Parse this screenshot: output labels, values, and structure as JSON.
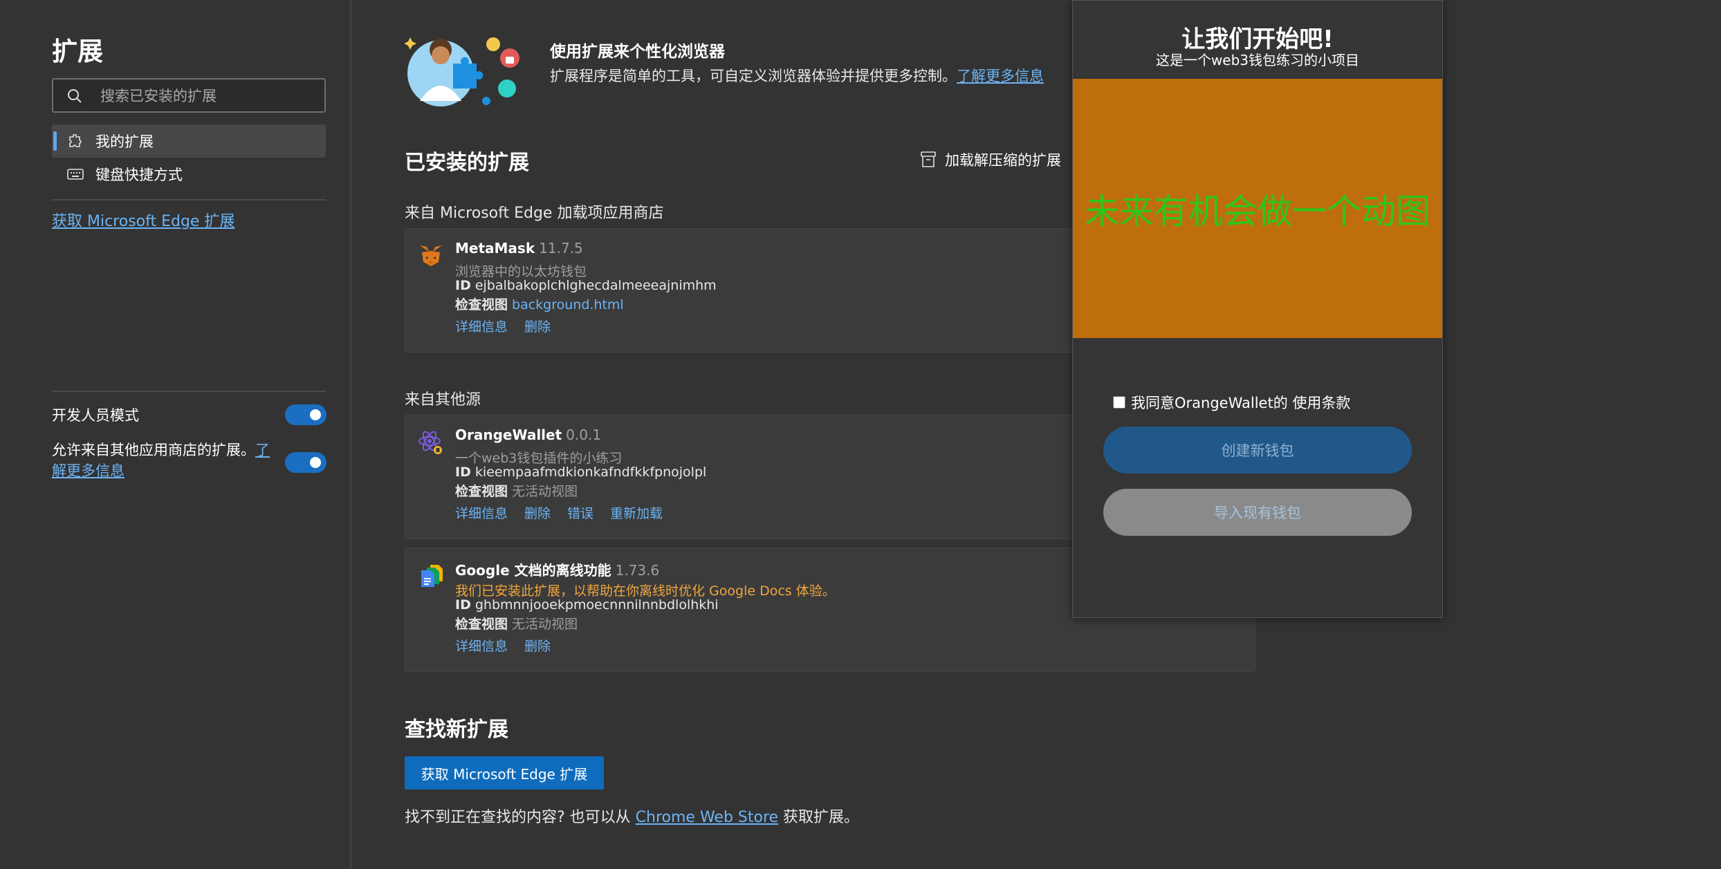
{
  "sidebar": {
    "title": "扩展",
    "search_placeholder": "搜索已安装的扩展",
    "items": [
      {
        "label": "我的扩展"
      },
      {
        "label": "键盘快捷方式"
      }
    ],
    "get_edge_link": "获取 Microsoft Edge 扩展",
    "dev_mode_label": "开发人员模式",
    "allow_other_text": "允许来自其他应用商店的扩展。",
    "allow_other_link": "了解更多信息"
  },
  "hero": {
    "title": "使用扩展来个性化浏览器",
    "desc": "扩展程序是简单的工具，可自定义浏览器体验并提供更多控制。",
    "link": "了解更多信息"
  },
  "installed": {
    "title": "已安装的扩展",
    "load_unpacked": "加载解压缩的扩展",
    "from_store_label": "来自 Microsoft Edge 加载项应用商店",
    "from_other_label": "来自其他源"
  },
  "extensions": [
    {
      "name": "MetaMask",
      "version": "11.7.5",
      "desc": "浏览器中的以太坊钱包",
      "id_label": "ID",
      "id": "ejbalbakoplchlghecdalmeeeajnimhm",
      "inspect_label": "检查视图",
      "inspect_value": "background.html",
      "actions": [
        "详细信息",
        "删除"
      ]
    },
    {
      "name": "OrangeWallet",
      "version": "0.0.1",
      "desc": "一个web3钱包插件的小练习",
      "id_label": "ID",
      "id": "kieempaafmdkionkafndfkkfpnojolpl",
      "inspect_label": "检查视图",
      "inspect_value": "无活动视图",
      "actions": [
        "详细信息",
        "删除",
        "错误",
        "重新加载"
      ]
    },
    {
      "name": "Google 文档的离线功能",
      "version": "1.73.6",
      "desc": "我们已安装此扩展，以帮助在你离线时优化 Google Docs 体验。",
      "id_label": "ID",
      "id": "ghbmnnjooekpmoecnnnilnnbdlolhkhi",
      "inspect_label": "检查视图",
      "inspect_value": "无活动视图",
      "actions": [
        "详细信息",
        "删除"
      ]
    }
  ],
  "find": {
    "title": "查找新扩展",
    "button": "获取 Microsoft Edge 扩展",
    "text_before": "找不到正在查找的内容? 也可以从 ",
    "link": "Chrome Web Store",
    "text_after": " 获取扩展。"
  },
  "popup": {
    "title": "让我们开始吧!",
    "subtitle": "这是一个web3钱包练习的小项目",
    "animation_text": "未来有机会做一个动图",
    "agree_text": "我同意OrangeWallet的 使用条款",
    "create_button": "创建新钱包",
    "import_button": "导入现有钱包"
  },
  "colors": {
    "background": "#333333",
    "accent": "#0f6cbd",
    "link": "#6cb4f5",
    "popup_banner": "#bf6e0d",
    "popup_banner_text": "#31c41c",
    "warning_text": "#f0a63c"
  }
}
